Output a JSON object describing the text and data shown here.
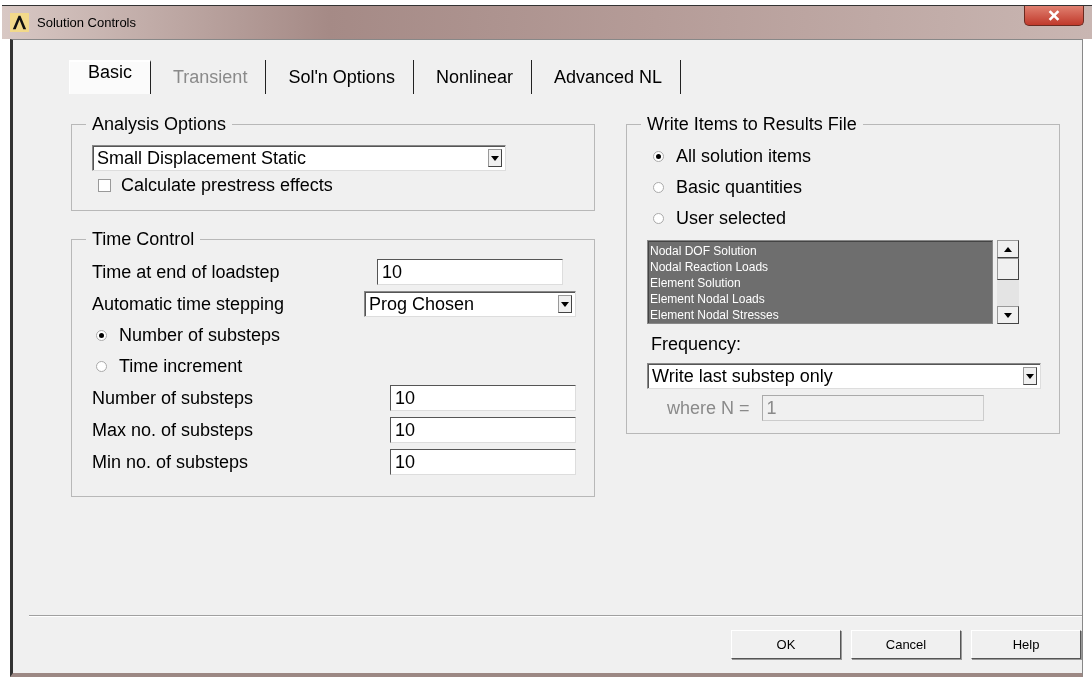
{
  "window": {
    "title": "Solution Controls"
  },
  "tabs": [
    {
      "label": "Basic",
      "selected": true,
      "disabled": false
    },
    {
      "label": "Transient",
      "selected": false,
      "disabled": true
    },
    {
      "label": "Sol'n Options",
      "selected": false,
      "disabled": false
    },
    {
      "label": "Nonlinear",
      "selected": false,
      "disabled": false
    },
    {
      "label": "Advanced NL",
      "selected": false,
      "disabled": false
    }
  ],
  "analysis_options": {
    "title": "Analysis Options",
    "analysis_type": "Small Displacement Static",
    "prestress": {
      "label": "Calculate prestress effects",
      "checked": false
    }
  },
  "time_control": {
    "title": "Time Control",
    "rows": [
      {
        "kind": "field",
        "label": "Time at end of loadstep",
        "value": "10"
      },
      {
        "kind": "dropdown",
        "label": "Automatic time stepping",
        "value": "Prog Chosen"
      },
      {
        "kind": "radio",
        "label": "Number of substeps",
        "selected": true
      },
      {
        "kind": "radio",
        "label": "Time increment",
        "selected": false
      },
      {
        "kind": "field",
        "label": "Number of substeps",
        "value": "10"
      },
      {
        "kind": "field",
        "label": "Max no. of substeps",
        "value": "10"
      },
      {
        "kind": "field",
        "label": "Min no. of substeps",
        "value": "10"
      }
    ]
  },
  "write_items": {
    "title": "Write Items to Results File",
    "options": [
      {
        "label": "All solution items",
        "selected": true
      },
      {
        "label": "Basic quantities",
        "selected": false
      },
      {
        "label": "User selected",
        "selected": false
      }
    ],
    "items": [
      {
        "label": "Nodal DOF Solution",
        "selected": true
      },
      {
        "label": "Nodal Reaction Loads",
        "selected": true
      },
      {
        "label": "Element Solution",
        "selected": true
      },
      {
        "label": "Element Nodal Loads",
        "selected": true
      },
      {
        "label": "Element Nodal Stresses",
        "selected": true
      }
    ],
    "frequency_label": "Frequency:",
    "frequency": "Write last substep only",
    "where_n": {
      "label": "where N =",
      "value": "1",
      "disabled": true
    }
  },
  "buttons": [
    "OK",
    "Cancel",
    "Help"
  ]
}
